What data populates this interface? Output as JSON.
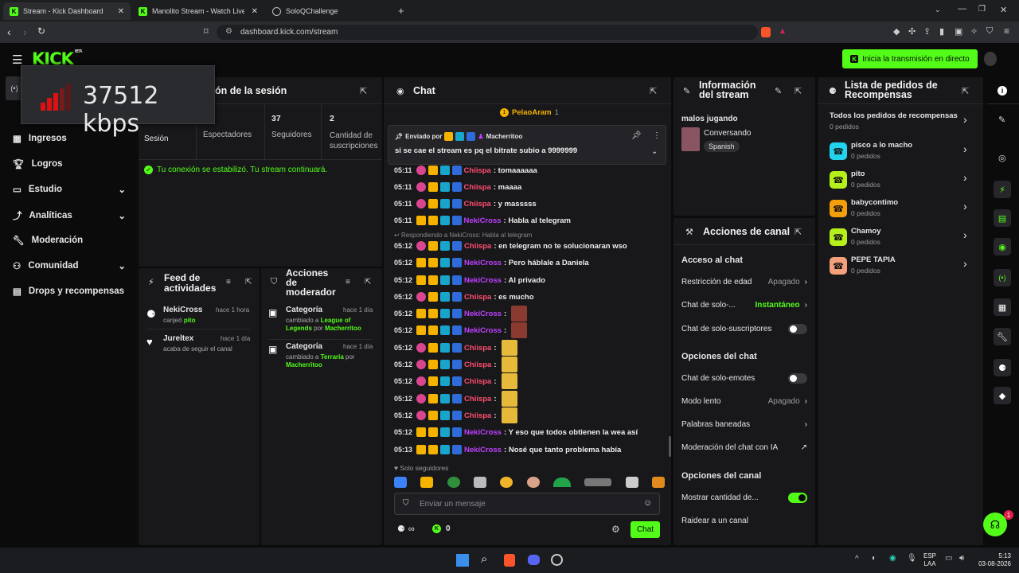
{
  "browser": {
    "tabs": [
      {
        "title": "Stream - Kick Dashboard"
      },
      {
        "title": "Manolito Stream - Watch Live on"
      },
      {
        "title": "SoloQChallenge"
      }
    ],
    "url": "dashboard.kick.com/stream"
  },
  "app": {
    "logo": "KICK",
    "logo_beta": "BETA",
    "go_live": "Inicia la transmisión en directo"
  },
  "overlay": {
    "bitrate": "37512 kbps"
  },
  "sidebar": {
    "items": [
      {
        "label": "Ingresos"
      },
      {
        "label": "Logros"
      },
      {
        "label": "Estudio"
      },
      {
        "label": "Analíticas"
      },
      {
        "label": "Moderación"
      },
      {
        "label": "Comunidad"
      },
      {
        "label": "Drops y recompensas"
      }
    ]
  },
  "session": {
    "title": "ón de la sesión",
    "stats": [
      {
        "value": "",
        "label": "Sesión"
      },
      {
        "value": "",
        "label": "Espectadores"
      },
      {
        "value": "37",
        "label": "Seguidores"
      },
      {
        "value": "2",
        "label": "Cantidad de suscripciones"
      }
    ],
    "status": "Tu conexión se estabilizó. Tu stream continuará."
  },
  "activity": {
    "title": "Feed de actividades",
    "items": [
      {
        "user": "NekiCross",
        "time": "hace 1 hora",
        "text": "canjeó",
        "highlight": "pito"
      },
      {
        "user": "Jureltex",
        "time": "hace 1 día",
        "text": "acaba de seguir el canal",
        "highlight": ""
      }
    ]
  },
  "modactions": {
    "title": "Acciones de moderador",
    "items": [
      {
        "title": "Categoría",
        "time": "hace 1 día",
        "pre": "cambiado a",
        "target": "League of Legends",
        "by": "por",
        "mod": "Macherritoo"
      },
      {
        "title": "Categoría",
        "time": "hace 1 día",
        "pre": "cambiado a",
        "target": "Terraria",
        "by": "por",
        "mod": "Macherritoo"
      }
    ]
  },
  "chat": {
    "title": "Chat",
    "top_user": "PelaoAram",
    "top_count": "1",
    "pinned": {
      "label": "Enviado por",
      "user": "Macherritoo",
      "text": "si se cae el stream es pq el bitrate subio a 9999999"
    },
    "reply_hint": "Respondiendo a NekiCross: Habla al telegram",
    "messages": [
      {
        "time": "05:11",
        "user": "Chiispa",
        "text": ": tomaaaaaa",
        "color": "#ff4d6d"
      },
      {
        "time": "05:11",
        "user": "Chiispa",
        "text": ": maaaa",
        "color": "#ff4d6d"
      },
      {
        "time": "05:11",
        "user": "Chiispa",
        "text": ": y masssss",
        "color": "#ff4d6d"
      },
      {
        "time": "05:11",
        "user": "NekiCross",
        "text": ": Habla al telegram",
        "color": "#c040ff"
      },
      {
        "time": "05:12",
        "user": "Chiispa",
        "text": ": en telegram no te solucionaran wso",
        "color": "#ff4d6d"
      },
      {
        "time": "05:12",
        "user": "NekiCross",
        "text": ": Pero háblale a Daniela",
        "color": "#c040ff"
      },
      {
        "time": "05:12",
        "user": "NekiCross",
        "text": ": Al privado",
        "color": "#c040ff"
      },
      {
        "time": "05:12",
        "user": "Chiispa",
        "text": ": es mucho",
        "color": "#ff4d6d"
      },
      {
        "time": "05:12",
        "user": "NekiCross",
        "text": ":",
        "color": "#c040ff"
      },
      {
        "time": "05:12",
        "user": "NekiCross",
        "text": ":",
        "color": "#c040ff"
      },
      {
        "time": "05:12",
        "user": "Chiispa",
        "text": ":",
        "color": "#ff4d6d"
      },
      {
        "time": "05:12",
        "user": "Chiispa",
        "text": ":",
        "color": "#ff4d6d"
      },
      {
        "time": "05:12",
        "user": "Chiispa",
        "text": ":",
        "color": "#ff4d6d"
      },
      {
        "time": "05:12",
        "user": "Chiispa",
        "text": ":",
        "color": "#ff4d6d"
      },
      {
        "time": "05:12",
        "user": "Chiispa",
        "text": ":",
        "color": "#ff4d6d"
      },
      {
        "time": "05:12",
        "user": "NekiCross",
        "text": ": Y eso que todos obtienen la wea así",
        "color": "#c040ff"
      },
      {
        "time": "05:13",
        "user": "NekiCross",
        "text": ": Nosé que tanto problema había",
        "color": "#c040ff"
      }
    ],
    "followers_only": "Solo seguidores",
    "input_placeholder": "Enviar un mensaje",
    "infinity": "∞",
    "points": "0",
    "send": "Chat"
  },
  "streaminfo": {
    "title": "Información del stream",
    "stream_title": "malos jugando",
    "category": "Conversando",
    "language": "Spanish"
  },
  "channelactions": {
    "title": "Acciones de canal",
    "sections": [
      {
        "heading": "Acceso al chat"
      },
      {
        "heading": "Opciones del chat"
      },
      {
        "heading": "Opciones del canal"
      }
    ],
    "rows": [
      {
        "label": "Restricción de edad",
        "value": "Apagado"
      },
      {
        "label": "Chat de solo-...",
        "value": "Instantáneo"
      },
      {
        "label": "Chat de solo-suscriptores",
        "value": ""
      },
      {
        "label": "Chat de solo-emotes",
        "value": ""
      },
      {
        "label": "Modo lento",
        "value": "Apagado"
      },
      {
        "label": "Palabras baneadas",
        "value": ""
      },
      {
        "label": "Moderación del chat con IA",
        "value": ""
      },
      {
        "label": "Mostrar cantidad de...",
        "value": ""
      },
      {
        "label": "Raidear a un canal",
        "value": ""
      }
    ]
  },
  "rewards": {
    "title": "Lista de pedidos de Recompensas",
    "all_title": "Todos los pedidos de recompensas",
    "all_count": "0 pedidos",
    "items": [
      {
        "name": "pisco a lo macho",
        "count": "0 pedidos",
        "color": "#22d3ee"
      },
      {
        "name": "pito",
        "count": "0 pedidos",
        "color": "#b6f01a"
      },
      {
        "name": "babycontimo",
        "count": "0 pedidos",
        "color": "#f59e0b"
      },
      {
        "name": "Chamoy",
        "count": "0 pedidos",
        "color": "#b6f01a"
      },
      {
        "name": "PEPE TAPIA",
        "count": "0 pedidos",
        "color": "#f4a07a"
      }
    ]
  },
  "help_badge": "1",
  "taskbar": {
    "lang": "ESP",
    "lang2": "LAA",
    "time": "5:13",
    "date": "03-08-2026"
  }
}
